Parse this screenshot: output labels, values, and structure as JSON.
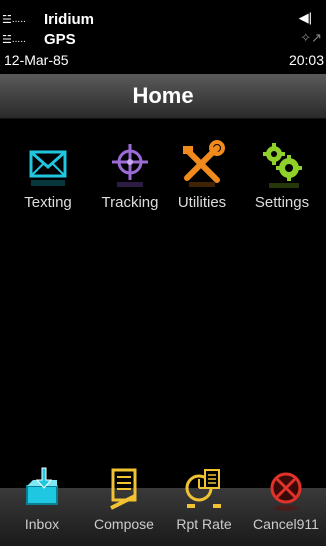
{
  "status": {
    "iridium_label": "Iridium",
    "gps_label": "GPS",
    "date": "12-Mar-85",
    "time": "20:03"
  },
  "header": {
    "title": "Home"
  },
  "apps": [
    {
      "label": "Texting",
      "icon": "envelope-icon"
    },
    {
      "label": "Tracking",
      "icon": "crosshair-icon"
    },
    {
      "label": "Utilities",
      "icon": "tools-icon"
    },
    {
      "label": "Settings",
      "icon": "gears-icon"
    }
  ],
  "toolbar": [
    {
      "label": "Inbox",
      "icon": "inbox-icon"
    },
    {
      "label": "Compose",
      "icon": "compose-icon"
    },
    {
      "label": "Rpt Rate",
      "icon": "report-rate-icon"
    },
    {
      "label": "Cancel911",
      "icon": "cancel-icon"
    }
  ],
  "colors": {
    "accent": "#1fc7e0",
    "tracking": "#9b6bd6",
    "utilities": "#f08a1c",
    "settings": "#8fd12a",
    "cancel": "#e0322b"
  }
}
